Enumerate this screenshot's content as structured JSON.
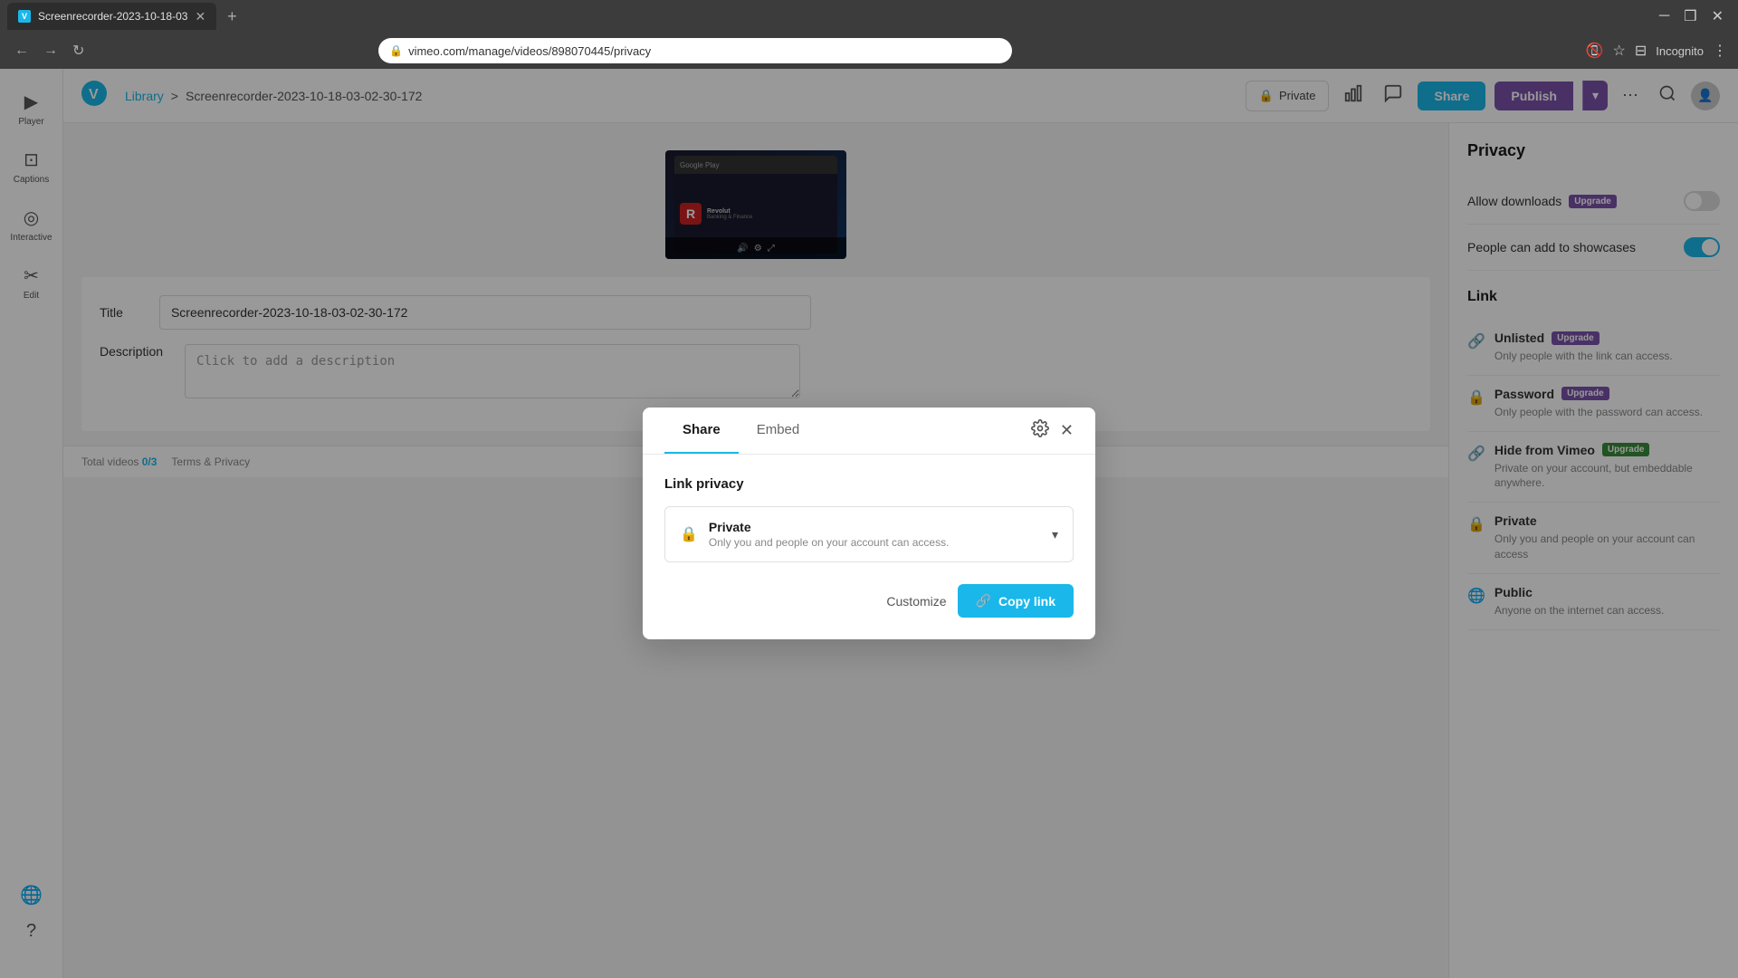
{
  "browser": {
    "tab_label": "Screenrecorder-2023-10-18-03",
    "tab_favicon": "V",
    "url": "vimeo.com/manage/videos/898070445/privacy",
    "incognito_label": "Incognito"
  },
  "header": {
    "logo": "V",
    "breadcrumb_home": "Library",
    "breadcrumb_sep": ">",
    "breadcrumb_current": "Screenrecorder-2023-10-18-03-02-30-172",
    "btn_private": "Private",
    "btn_share": "Share",
    "btn_publish": "Publish",
    "btn_more": "⋯"
  },
  "sidebar": {
    "items": [
      {
        "label": "Player",
        "icon": "▶"
      },
      {
        "label": "Captions",
        "icon": "⊡"
      },
      {
        "label": "Interactive",
        "icon": "◎"
      },
      {
        "label": "Edit",
        "icon": "✂"
      }
    ]
  },
  "form": {
    "title_label": "Title",
    "title_value": "Screenrecorder-2023-10-18-03-02-30-172",
    "description_label": "Description",
    "description_placeholder": "Click to add a description",
    "total_videos_label": "Total videos",
    "total_videos_count": "0/3",
    "footer_terms": "Terms & Privacy"
  },
  "right_panel": {
    "title": "Privacy",
    "allow_downloads_label": "Allow downloads",
    "allow_downloads_upgrade": "Upgrade",
    "showcases_label": "People can add to showcases",
    "link_title": "Link",
    "link_options": [
      {
        "title": "Unlisted",
        "upgrade": "Upgrade",
        "desc": "Only people with the link can access."
      },
      {
        "title": "Password",
        "upgrade": "Upgrade",
        "desc": "Only people with the password can access."
      },
      {
        "title": "Hide from Vimeo",
        "upgrade": "Upgrade",
        "desc": "Private on your account, but embeddable anywhere."
      },
      {
        "title": "Private",
        "upgrade": "",
        "desc": "Only you and people on your account can access"
      },
      {
        "title": "Public",
        "upgrade": "",
        "desc": "Anyone on the internet can access."
      }
    ]
  },
  "modal": {
    "tab_share": "Share",
    "tab_embed": "Embed",
    "link_privacy_title": "Link privacy",
    "privacy_name": "Private",
    "privacy_desc": "Only you and people on your account can access.",
    "btn_customize": "Customize",
    "btn_copy_link": "Copy link"
  }
}
